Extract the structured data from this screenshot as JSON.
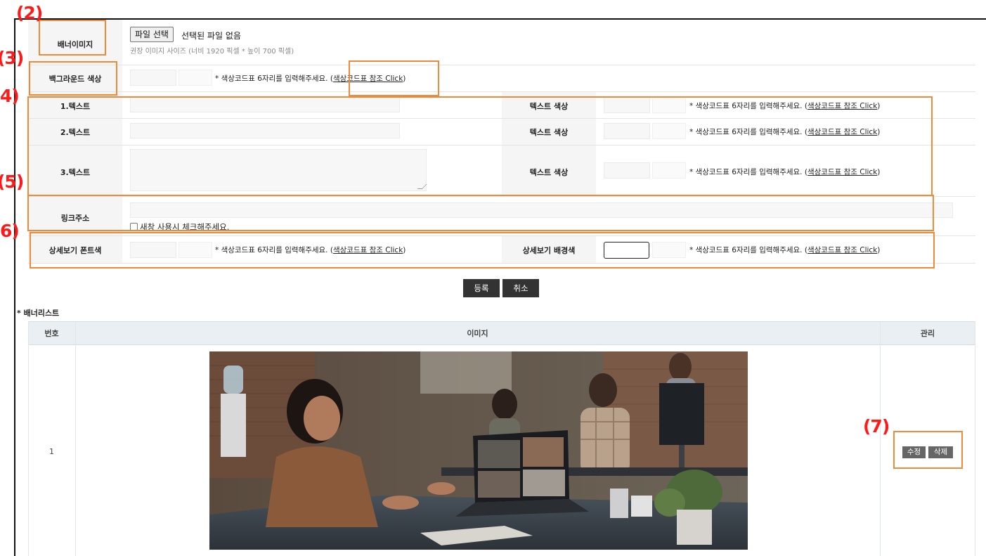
{
  "annotations": {
    "a2": "(2)",
    "a3": "(3)",
    "a4": "4)",
    "a5": "(5)",
    "a6": "6)",
    "a7": "(7)"
  },
  "form": {
    "banner_image": {
      "label": "배너이미지",
      "file_button": "파일 선택",
      "file_state": "선택된 파일 없음",
      "size_hint": "권장 이미지 사이즈 (너비 1920 픽셀 * 높이 700 픽셀)"
    },
    "bg_color": {
      "label": "백그라운드 색상",
      "hint": "* 색상코드표 6자리를 입력해주세요. (",
      "link": "색상코드표 참조 Click",
      "close": ")"
    },
    "texts": [
      {
        "label": "1.텍스트",
        "color_label": "텍스트 색상"
      },
      {
        "label": "2.텍스트",
        "color_label": "텍스트 색상"
      },
      {
        "label": "3.텍스트",
        "color_label": "텍스트 색상"
      }
    ],
    "color_hint": "* 색상코드표 6자리를 입력해주세요. (",
    "color_link": "색상코드표 참조 Click",
    "color_close": ")",
    "link": {
      "label": "링크주소",
      "new_window_label": "새창 사용시 체크해주세요."
    },
    "detail": {
      "font_label": "상세보기 폰트색",
      "bg_label": "상세보기 배경색"
    },
    "submit": "등록",
    "cancel": "취소"
  },
  "list": {
    "title": "* 배너리스트",
    "columns": [
      "번호",
      "이미지",
      "관리"
    ],
    "rows": [
      {
        "number": "1",
        "edit": "수정",
        "delete": "삭제"
      }
    ]
  }
}
